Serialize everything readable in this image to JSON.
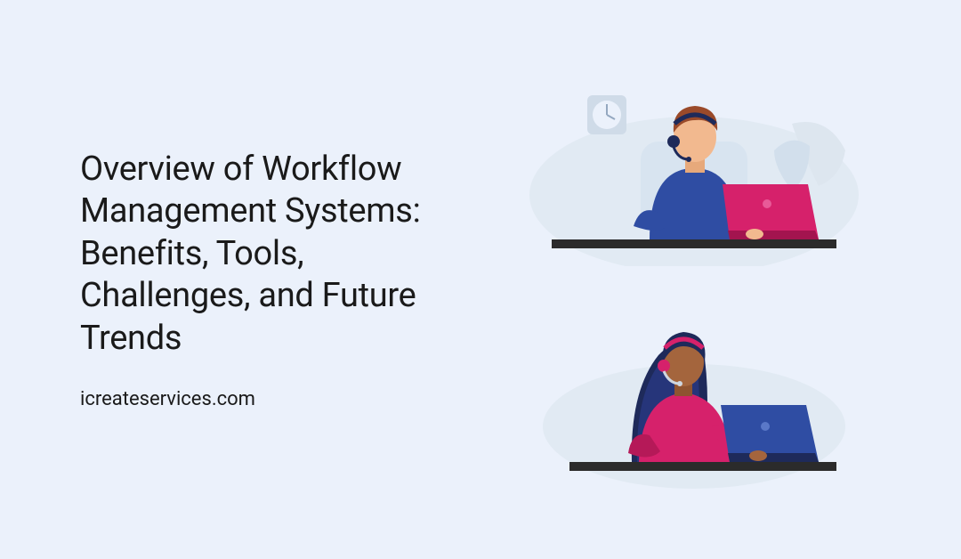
{
  "hero": {
    "headline": "Overview of Workflow Management Systems: Benefits, Tools, Challenges, and Future Trends",
    "domain": "icreateservices.com"
  },
  "illustrations": {
    "top": {
      "description": "man-with-headset-at-laptop",
      "colors": {
        "shirt": "#2f4da3",
        "laptop": "#d6216b",
        "laptop_shadow": "#a3144f",
        "skin": "#f2b98f",
        "hair": "#9a4a2a",
        "headset": "#1e2a5a",
        "desk": "#2b2b2b",
        "chair": "#d8e4f0",
        "plant": "#dde6ef",
        "clock": "#cfdbe8",
        "bg_shape": "#e1eaf3"
      }
    },
    "bottom": {
      "description": "woman-with-headset-at-laptop",
      "colors": {
        "shirt": "#d6216b",
        "laptop": "#2f4da3",
        "laptop_shadow": "#1e2a5a",
        "skin": "#a4653d",
        "hair": "#1e2a5a",
        "headset": "#d6216b",
        "desk": "#2b2b2b",
        "bg_shape": "#e1eaf3"
      }
    }
  }
}
